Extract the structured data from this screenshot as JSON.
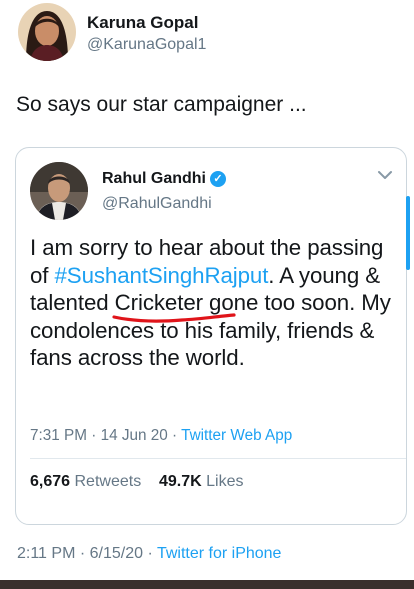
{
  "outer_tweet": {
    "author_name": "Karuna Gopal",
    "author_handle": "@KarunaGopal1",
    "text": "So says our star campaigner ...",
    "time": "2:11 PM",
    "date": "6/15/20",
    "source": "Twitter for iPhone"
  },
  "quoted_tweet": {
    "author_name": "Rahul Gandhi",
    "author_handle": "@RahulGandhi",
    "verified_icon": "verified-badge-icon",
    "text_part1": "I am sorry to hear about the passing of ",
    "hashtag": "#SushantSinghRajput",
    "text_part2": ". A young & talented ",
    "underlined_word": "Cricketer",
    "text_part3": " gone too soon. My condolences to his family, friends & fans across the world.",
    "time": "7:31 PM",
    "date": "14 Jun 20",
    "source": "Twitter Web App",
    "retweets_count": "6,676",
    "retweets_label": "Retweets",
    "likes_count": "49.7K",
    "likes_label": "Likes"
  },
  "separators": {
    "dot": " · "
  },
  "colors": {
    "link": "#1da1f2",
    "secondary_text": "#657786",
    "underline_annotation": "#e0141a",
    "bottom_bar": "#3a2f2c"
  }
}
